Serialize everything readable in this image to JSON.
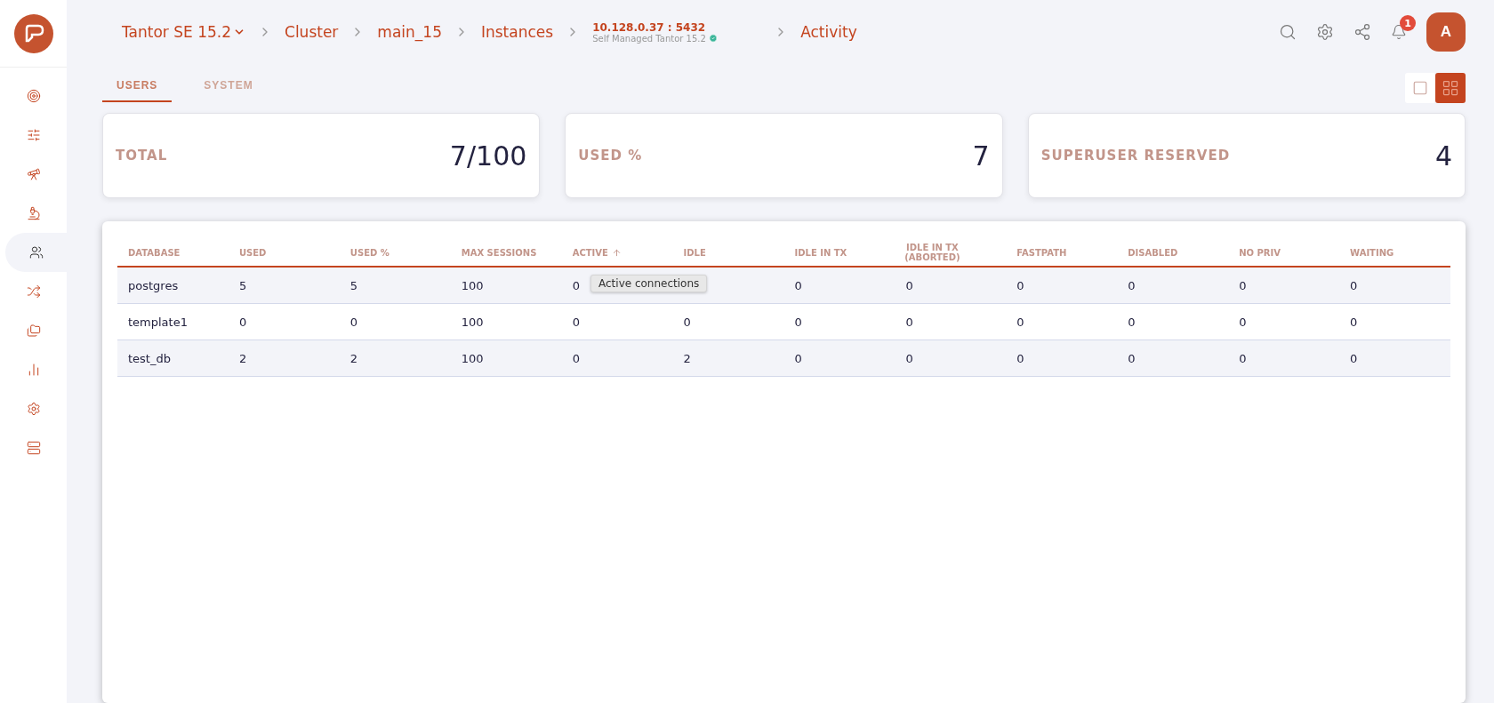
{
  "breadcrumbs": [
    {
      "kind": "dropdown",
      "label": "Tantor SE 15.2"
    },
    {
      "kind": "link",
      "label": "Cluster"
    },
    {
      "kind": "link",
      "label": "main_15"
    },
    {
      "kind": "link",
      "label": "Instances"
    },
    {
      "kind": "instance",
      "label": "10.128.0.37 : 5432",
      "sublabel": "Self Managed Tantor 15.2"
    },
    {
      "kind": "link",
      "label": "Activity"
    }
  ],
  "header": {
    "notifications": "1",
    "avatar": "A"
  },
  "sidebar": {
    "items": [
      {
        "selected": false
      },
      {
        "selected": false
      },
      {
        "selected": false
      },
      {
        "selected": false
      },
      {
        "selected": true
      },
      {
        "selected": false
      },
      {
        "selected": false
      },
      {
        "selected": false
      },
      {
        "selected": false
      },
      {
        "selected": false
      }
    ]
  },
  "tabs": [
    {
      "label": "USERS",
      "selected": true
    },
    {
      "label": "SYSTEM",
      "selected": false
    }
  ],
  "view_toggle": [
    {
      "kind": "single",
      "selected": false
    },
    {
      "kind": "grid",
      "selected": true
    }
  ],
  "stats": [
    {
      "label": "TOTAL",
      "value": "7/100"
    },
    {
      "label": "USED %",
      "value": "7"
    },
    {
      "label": "SUPERUSER RESERVED",
      "value": "4"
    }
  ],
  "table": {
    "columns": [
      {
        "label": "DATABASE",
        "sorted": false
      },
      {
        "label": "USED",
        "sorted": false
      },
      {
        "label": "USED %",
        "sorted": false
      },
      {
        "label": "MAX SESSIONS",
        "sorted": false
      },
      {
        "label": "ACTIVE",
        "sorted": true
      },
      {
        "label": "IDLE",
        "sorted": false
      },
      {
        "label": "IDLE IN TX",
        "sorted": false
      },
      {
        "label": "IDLE IN TX (ABORTED)",
        "sorted": false
      },
      {
        "label": "FASTPATH",
        "sorted": false
      },
      {
        "label": "DISABLED",
        "sorted": false
      },
      {
        "label": "NO PRIV",
        "sorted": false
      },
      {
        "label": "WAITING",
        "sorted": false
      }
    ],
    "rows": [
      [
        "postgres",
        "5",
        "5",
        "100",
        "0",
        null,
        "0",
        "0",
        "0",
        "0",
        "0",
        "0"
      ],
      [
        "template1",
        "0",
        "0",
        "100",
        "0",
        "0",
        "0",
        "0",
        "0",
        "0",
        "0",
        "0"
      ],
      [
        "test_db",
        "2",
        "2",
        "100",
        "0",
        "2",
        "0",
        "0",
        "0",
        "0",
        "0",
        "0"
      ]
    ],
    "tooltip": "Active connections"
  }
}
